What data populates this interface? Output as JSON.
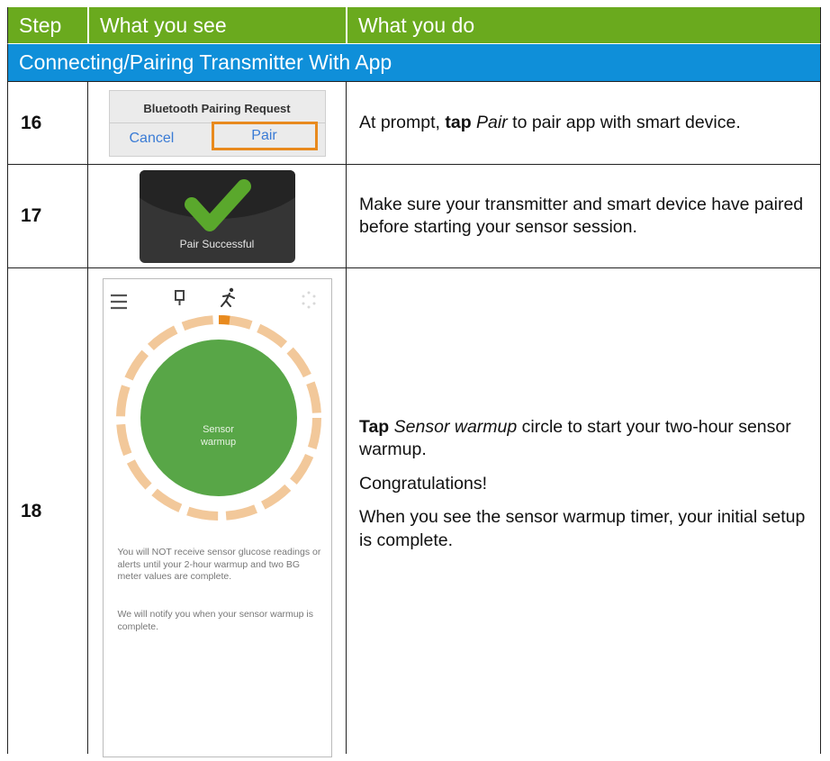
{
  "header": {
    "col1": "Step",
    "col2": "What you see",
    "col3": "What you do"
  },
  "section_title": "Connecting/Pairing Transmitter With App",
  "rows": [
    {
      "step": "16",
      "dialog": {
        "title": "Bluetooth Pairing Request",
        "cancel": "Cancel",
        "pair": "Pair"
      },
      "instruction": {
        "bold": "tap",
        "pre": "At prompt, ",
        "italic": "Pair",
        "post": " to pair app with smart device."
      }
    },
    {
      "step": "17",
      "popup_label": "Pair Successful",
      "instruction": "Make sure your transmitter and smart device have paired before starting your sensor session."
    },
    {
      "step": "18",
      "phone": {
        "circle_label_1": "Sensor",
        "circle_label_2": "warmup",
        "note_1": "You will NOT receive sensor glucose readings or alerts until your 2-hour warmup and two BG meter values are complete.",
        "note_2": "We will notify you when your sensor warmup is complete."
      },
      "instruction": {
        "bold": "Tap",
        "italic": "Sensor warmup",
        "post": " circle to start your two-hour sensor warmup.",
        "para2": "Congratulations!",
        "para3": "When you see the sensor warmup timer, your initial setup is complete."
      }
    }
  ],
  "colors": {
    "header": "#6aaa1e",
    "section": "#0f8fd9",
    "highlight": "#e88a1e",
    "check": "#5aa82c",
    "ring": "#f2c89a",
    "circle": "#58a647"
  }
}
